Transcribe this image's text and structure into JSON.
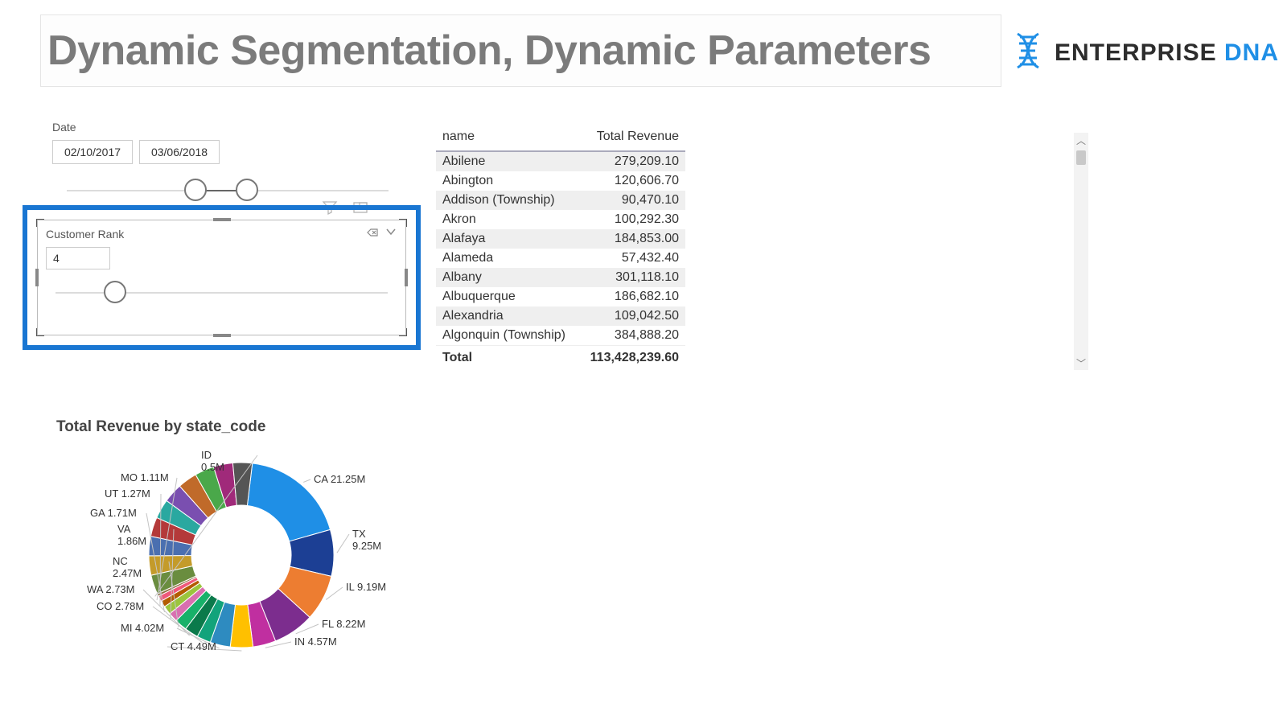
{
  "title": "Dynamic Segmentation, Dynamic Parameters",
  "brand": {
    "text1": "ENTERPRISE ",
    "text2": "DNA"
  },
  "date_slicer": {
    "label": "Date",
    "from": "02/10/2017",
    "to": "03/06/2018",
    "handle1_pct": 40,
    "handle2_pct": 56
  },
  "rank_slicer": {
    "label": "Customer Rank",
    "value": "4",
    "handle_pct": 18
  },
  "table": {
    "col_name": "name",
    "col_rev": "Total Revenue",
    "rows": [
      {
        "name": "Abilene",
        "rev": "279,209.10"
      },
      {
        "name": "Abington",
        "rev": "120,606.70"
      },
      {
        "name": "Addison (Township)",
        "rev": "90,470.10"
      },
      {
        "name": "Akron",
        "rev": "100,292.30"
      },
      {
        "name": "Alafaya",
        "rev": "184,853.00"
      },
      {
        "name": "Alameda",
        "rev": "57,432.40"
      },
      {
        "name": "Albany",
        "rev": "301,118.10"
      },
      {
        "name": "Albuquerque",
        "rev": "186,682.10"
      },
      {
        "name": "Alexandria",
        "rev": "109,042.50"
      },
      {
        "name": "Algonquin (Township)",
        "rev": "384,888.20"
      }
    ],
    "total_label": "Total",
    "total_value": "113,428,239.60"
  },
  "chart_data": {
    "type": "donut",
    "title": "Total Revenue by state_code",
    "series": [
      {
        "name": "CA",
        "value": 21.25,
        "label": "CA 21.25M",
        "color": "#1f8fe6"
      },
      {
        "name": "TX",
        "value": 9.25,
        "label_l1": "TX",
        "label_l2": "9.25M",
        "color": "#1c3f94"
      },
      {
        "name": "IL",
        "value": 9.19,
        "label": "IL 9.19M",
        "color": "#ed7d31"
      },
      {
        "name": "FL",
        "value": 8.22,
        "label": "FL 8.22M",
        "color": "#7c2d8e"
      },
      {
        "name": "IN",
        "value": 4.57,
        "label": "IN 4.57M",
        "color": "#c02fa0"
      },
      {
        "name": "CT",
        "value": 4.49,
        "label": "CT 4.49M",
        "color": "#ffc000"
      },
      {
        "name": "MI",
        "value": 4.02,
        "label": "MI 4.02M",
        "color": "#2e8bc0"
      },
      {
        "name": "CO",
        "value": 2.78,
        "label": "CO 2.78M",
        "color": "#12a37b"
      },
      {
        "name": "WA",
        "value": 2.73,
        "label": "WA 2.73M",
        "color": "#0b7a4b"
      },
      {
        "name": "NC",
        "value": 2.47,
        "label_l1": "NC",
        "label_l2": "2.47M",
        "color": "#17b169"
      },
      {
        "name": "VA",
        "value": 1.86,
        "label_l1": "VA",
        "label_l2": "1.86M",
        "color": "#d96fb0"
      },
      {
        "name": "GA",
        "value": 1.71,
        "label": "GA 1.71M",
        "color": "#9bc53d"
      },
      {
        "name": "UT",
        "value": 1.27,
        "label": "UT 1.27M",
        "color": "#b35c00"
      },
      {
        "name": "MO",
        "value": 1.11,
        "label": "MO 1.11M",
        "color": "#ef597b"
      },
      {
        "name": "ID",
        "value": 0.5,
        "label_l1": "ID",
        "label_l2": "0.5M",
        "color": "#8c6d3f"
      }
    ],
    "other_fill": 38.5
  }
}
